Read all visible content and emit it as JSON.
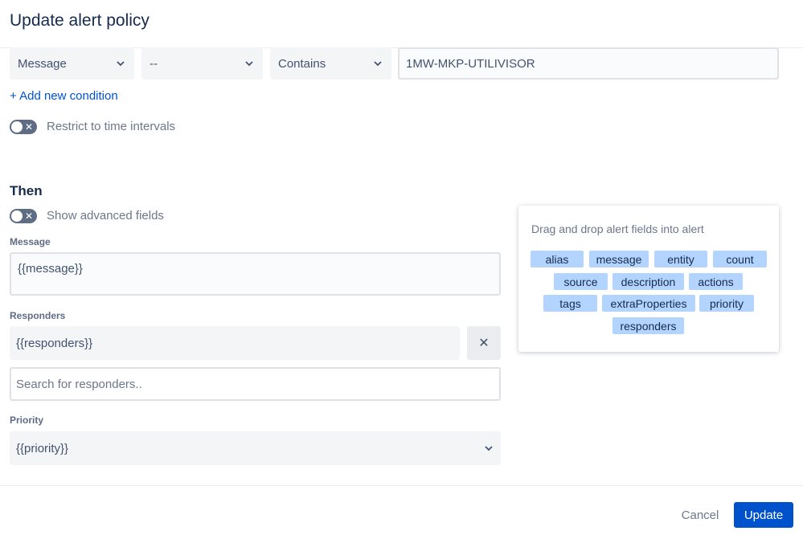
{
  "dialog": {
    "title": "Update alert policy"
  },
  "conditions": {
    "field": "Message",
    "not_op": "--",
    "operation": "Contains",
    "value": "1MW-MKP-UTILIVISOR",
    "add_label": "+ Add new condition",
    "restrict_label": "Restrict to time intervals"
  },
  "then": {
    "title": "Then",
    "advanced_label": "Show advanced fields",
    "message_label": "Message",
    "message_value": "{{message}}",
    "responders_label": "Responders",
    "responders_value": "{{responders}}",
    "search_placeholder": "Search for responders..",
    "priority_label": "Priority",
    "priority_value": "{{priority}}"
  },
  "fields_panel": {
    "title": "Drag and drop alert fields into alert",
    "chips": [
      "alias",
      "message",
      "entity",
      "count",
      "source",
      "description",
      "actions",
      "tags",
      "extraProperties",
      "priority",
      "responders"
    ]
  },
  "footer": {
    "cancel_label": "Cancel",
    "update_label": "Update"
  },
  "colors": {
    "primary": "#0052cc",
    "chip": "#b3d4ff",
    "toggle_off": "#5e6c84"
  },
  "icons": [
    "chevron-down-icon",
    "close-icon",
    "toggle-x-icon"
  ]
}
